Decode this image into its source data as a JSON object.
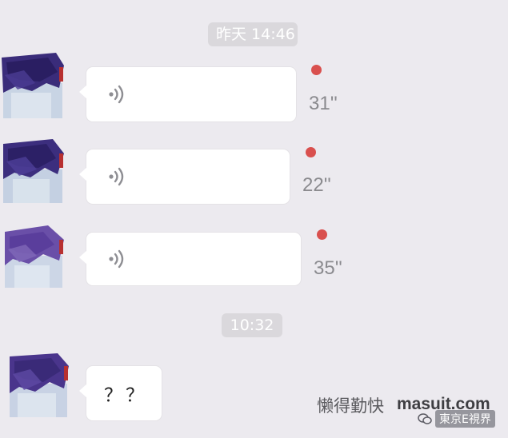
{
  "timestamps": {
    "first": "昨天 14:46",
    "second": "10:32"
  },
  "messages": [
    {
      "type": "voice",
      "duration": "31''",
      "unread": true,
      "icon": "voice-wave-icon"
    },
    {
      "type": "voice",
      "duration": "22''",
      "unread": true,
      "icon": "voice-wave-icon"
    },
    {
      "type": "voice",
      "duration": "35''",
      "unread": true,
      "icon": "voice-wave-icon"
    },
    {
      "type": "text",
      "text": "？？"
    }
  ],
  "watermark": {
    "cn_text": "懒得勤快",
    "url": "masuit.com",
    "badge_text": "東京E視界",
    "badge_icon": "wechat-chat-icon"
  },
  "colors": {
    "background": "#ECEAEF",
    "bubble": "#FFFFFF",
    "unread_dot": "#D9504E",
    "timestamp_pill": "#DAD8DC",
    "duration_text": "#8A8A8E"
  }
}
